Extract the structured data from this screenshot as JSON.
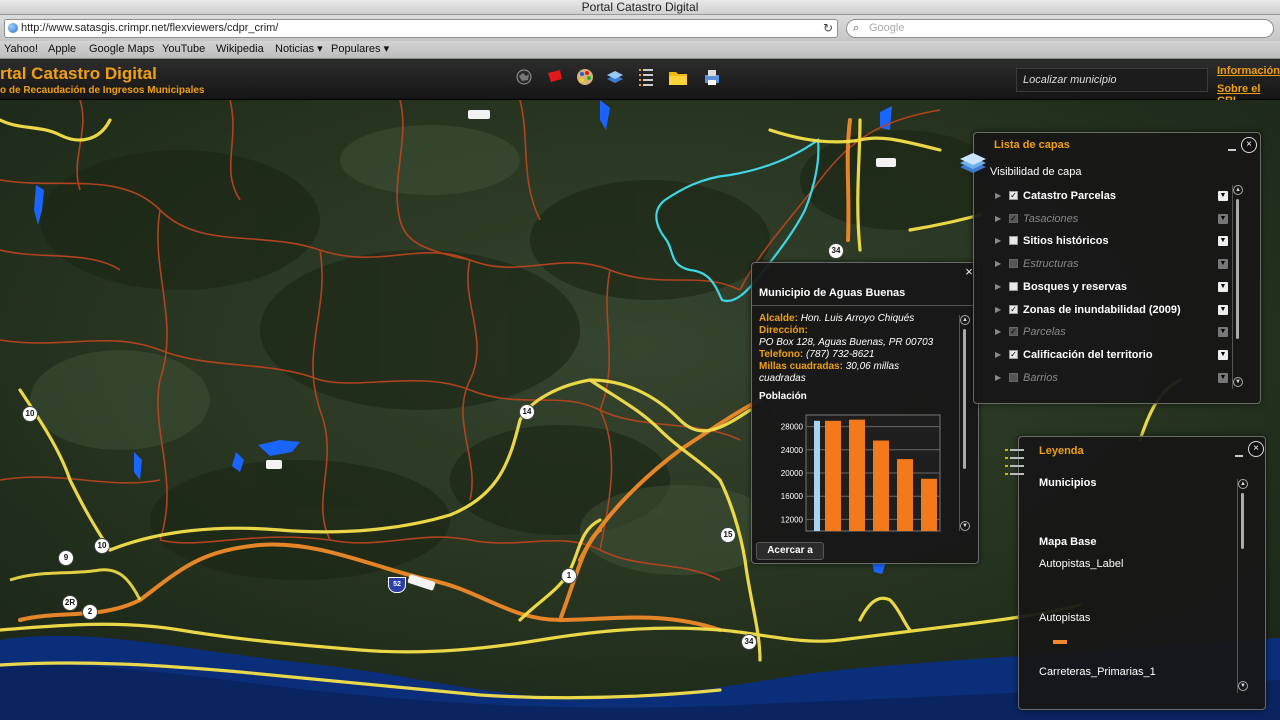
{
  "browser": {
    "window_title": "Portal Catastro Digital",
    "url": "http://www.satasgis.crimpr.net/flexviewers/cdpr_crim/",
    "search_placeholder": "Google",
    "bookmarks": [
      "Yahoo!",
      "Apple",
      "Google Maps",
      "YouTube",
      "Wikipedia",
      "Noticias ▾",
      "Populares ▾"
    ]
  },
  "header": {
    "title": "rtal Catastro Digital",
    "subtitle": "o de Recaudación de Ingresos Municipales",
    "locate_placeholder": "Localizar municipio",
    "links": [
      "Información",
      "Sobre el CRI"
    ],
    "tools": [
      "globe-icon",
      "flag-icon",
      "palette-icon",
      "layers-icon",
      "list-icon",
      "folder-icon",
      "print-icon"
    ]
  },
  "map": {
    "route_shields": [
      "10",
      "14",
      "9",
      "10",
      "2R",
      "2",
      "1",
      "15",
      "34",
      "34"
    ],
    "interstate_shield": "52",
    "accent_colors": {
      "highway": "#f5e14a",
      "secondary": "#f08a28",
      "boundary": "#b8441e",
      "selected": "#3fd6e8",
      "water": "#1a64ff"
    }
  },
  "popup": {
    "title": "Municipio de Aguas Buenas",
    "close": "×",
    "alcalde_label": "Alcalde:",
    "alcalde_value": "Hon. Luis Arroyo Chiqués",
    "direccion_label": "Dirección:",
    "direccion_value": "PO Box 128, Aguas Buenas, PR 00703",
    "telefono_label": "Telefono:",
    "telefono_value": "(787) 732-8621",
    "millas_label": "Millas cuadradas:",
    "millas_value": "30,06 millas",
    "millas_unit": "cuadradas",
    "poblacion_label": "Población",
    "zoom_button": "Acercar a"
  },
  "chart_data": {
    "type": "bar",
    "title": "Población",
    "yticks": [
      28000,
      24000,
      20000,
      16000,
      12000
    ],
    "ylim": [
      10000,
      30000
    ],
    "values": [
      29000,
      29200,
      25600,
      22400,
      19000
    ],
    "highlight_value": 29000,
    "colors": {
      "bar": "#f27a1a",
      "highlight": "#a9d3f5"
    }
  },
  "layers": {
    "title": "Lista de capas",
    "subtitle": "Visibilidad de capa",
    "items": [
      {
        "label": "Catastro Parcelas",
        "checked": true,
        "sub": false
      },
      {
        "label": "Tasaciones",
        "checked": true,
        "sub": true
      },
      {
        "label": "Sitios históricos",
        "checked": false,
        "sub": false
      },
      {
        "label": "Estructuras",
        "checked": false,
        "sub": true
      },
      {
        "label": "Bosques y reservas",
        "checked": false,
        "sub": false
      },
      {
        "label": "Zonas de inundabilidad (2009)",
        "checked": true,
        "sub": false
      },
      {
        "label": "Parcelas",
        "checked": true,
        "sub": true
      },
      {
        "label": "Calificación del territorio",
        "checked": true,
        "sub": false
      },
      {
        "label": "Barrios",
        "checked": false,
        "sub": true
      }
    ]
  },
  "legend": {
    "title": "Leyenda",
    "municipios": "Municipios",
    "mapa_base": "Mapa Base",
    "autopistas_label": "Autopistas_Label",
    "autopistas": "Autopistas",
    "carreteras": "Carreteras_Primarias_1"
  }
}
